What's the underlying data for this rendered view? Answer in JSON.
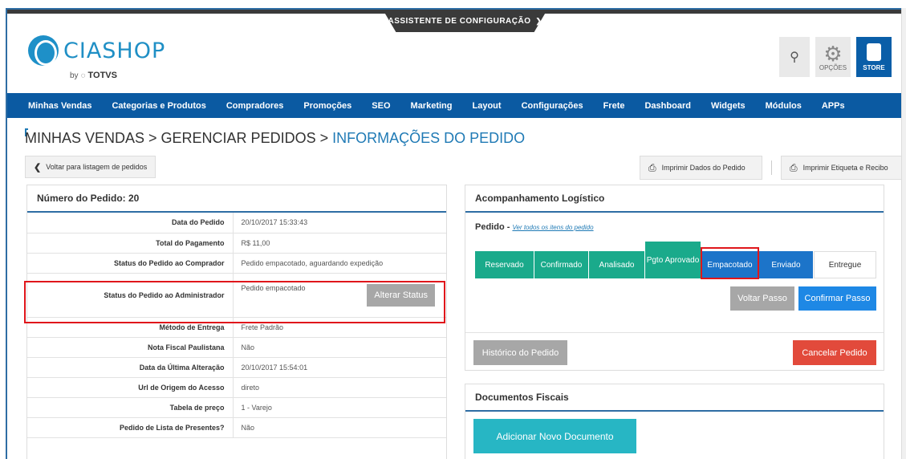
{
  "header": {
    "assistant_label": "ASSISTENTE DE CONFIGURAÇÃO",
    "logo_text": "CIASHOP",
    "logo_by": "by",
    "logo_brand": "TOTVS",
    "options_label": "OPÇÕES",
    "store_label": "STORE"
  },
  "nav": {
    "items": [
      "Minhas Vendas",
      "Categorias e Produtos",
      "Compradores",
      "Promoções",
      "SEO",
      "Marketing",
      "Layout",
      "Configurações",
      "Frete",
      "Dashboard",
      "Widgets",
      "Módulos",
      "APPs"
    ]
  },
  "breadcrumb": {
    "part1": "MINHAS VENDAS > GERENCIAR PEDIDOS > ",
    "current": "INFORMAÇÕES DO PEDIDO"
  },
  "actions": {
    "back": "Voltar para listagem de pedidos",
    "print_data": "Imprimir Dados do Pedido",
    "print_label": "Imprimir Etiqueta e Recibo"
  },
  "order": {
    "title": "Número do Pedido: 20",
    "rows": [
      {
        "k": "Data do Pedido",
        "v": "20/10/2017 15:33:43"
      },
      {
        "k": "Total do Pagamento",
        "v": "R$ 11,00"
      },
      {
        "k": "Status do Pedido ao Comprador",
        "v": "Pedido empacotado, aguardando expedição"
      },
      {
        "k": "Status do Pedido ao Administrador",
        "v": "Pedido empacotado"
      },
      {
        "k": "Método de Entrega",
        "v": "Frete Padrão"
      },
      {
        "k": "Nota Fiscal Paulistana",
        "v": "Não"
      },
      {
        "k": "Data da Última Alteração",
        "v": "20/10/2017 15:54:01"
      },
      {
        "k": "Url de Origem do Acesso",
        "v": "direto"
      },
      {
        "k": "Tabela de preço",
        "v": "1 - Varejo"
      },
      {
        "k": "Pedido de Lista de Presentes?",
        "v": "Não"
      }
    ],
    "alter_status": "Alterar Status"
  },
  "logistics": {
    "title": "Acompanhamento Logístico",
    "sub_label": "Pedido -",
    "sub_link": "Ver todos os itens do pedido",
    "steps": [
      "Reservado",
      "Confirmado",
      "Analisado",
      "Pgto Aprovado",
      "Empacotado",
      "Enviado",
      "Entregue"
    ],
    "back_step": "Voltar Passo",
    "confirm_step": "Confirmar Passo",
    "history": "Histórico do Pedido",
    "cancel": "Cancelar Pedido"
  },
  "fiscal": {
    "title": "Documentos Fiscais",
    "add_doc": "Adicionar Novo Documento"
  }
}
